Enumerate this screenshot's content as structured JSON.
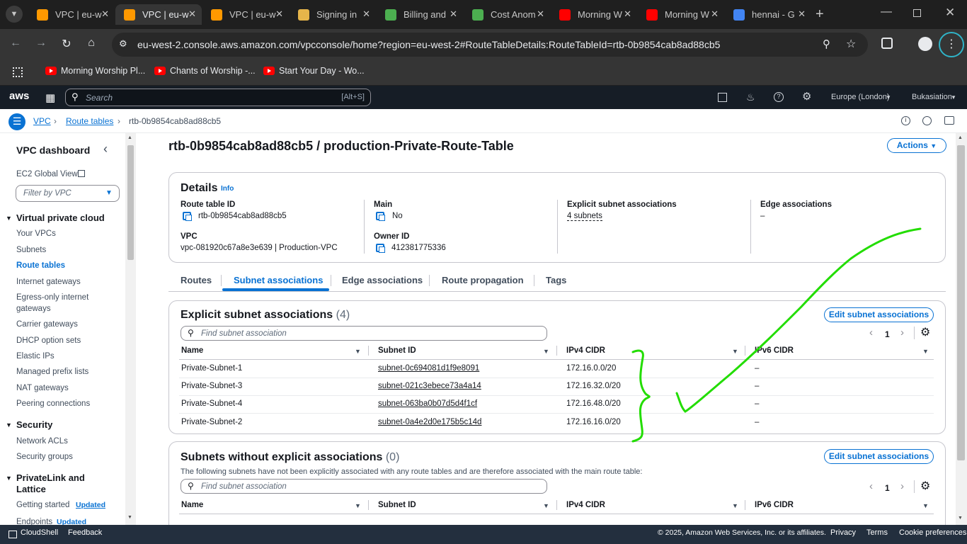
{
  "browser": {
    "tabs": [
      {
        "title": "VPC | eu-w",
        "favicon": "aws-cube-icon",
        "color": "#f90"
      },
      {
        "title": "VPC | eu-w",
        "favicon": "aws-cube-icon",
        "color": "#f90"
      },
      {
        "title": "VPC | eu-w",
        "favicon": "aws-cube-icon",
        "color": "#f90"
      },
      {
        "title": "Signing in",
        "favicon": "package-icon",
        "color": "#e6b54a"
      },
      {
        "title": "Billing and",
        "favicon": "billing-icon",
        "color": "#4caf50"
      },
      {
        "title": "Cost Anom",
        "favicon": "cost-icon",
        "color": "#4caf50"
      },
      {
        "title": "Morning W",
        "favicon": "youtube-icon",
        "color": "#f00"
      },
      {
        "title": "Morning W",
        "favicon": "youtube-icon",
        "color": "#f00"
      },
      {
        "title": "hennai - G",
        "favicon": "google-icon",
        "color": "#4285f4"
      }
    ],
    "url": "eu-west-2.console.aws.amazon.com/vpcconsole/home?region=eu-west-2#RouteTableDetails:RouteTableId=rtb-0b9854cab8ad88cb5",
    "bookmarks": [
      "Morning Worship Pl...",
      "Chants of Worship -...",
      "Start Your Day - Wo..."
    ]
  },
  "aws": {
    "logo": "aws",
    "search_placeholder": "Search",
    "search_shortcut": "[Alt+S]",
    "region": "Europe (London)",
    "account": "Bukasiation"
  },
  "breadcrumb": [
    "VPC",
    "Route tables",
    "rtb-0b9854cab8ad88cb5"
  ],
  "sidebar": {
    "title": "VPC dashboard",
    "ec2_global": "EC2 Global View",
    "filter_placeholder": "Filter by VPC",
    "sections": [
      {
        "header": "Virtual private cloud",
        "items": [
          "Your VPCs",
          "Subnets",
          "Route tables",
          "Internet gateways",
          "Egress-only internet",
          "gateways",
          "Carrier gateways",
          "DHCP option sets",
          "Elastic IPs",
          "Managed prefix lists",
          "NAT gateways",
          "Peering connections"
        ]
      },
      {
        "header": "Security",
        "items": [
          "Network ACLs",
          "Security groups"
        ]
      },
      {
        "header_line1": "PrivateLink and",
        "header_line2": "Lattice",
        "items": [
          "Getting started",
          "Endpoints"
        ],
        "badge": "Updated"
      }
    ]
  },
  "page": {
    "title": "rtb-0b9854cab8ad88cb5 / production-Private-Route-Table",
    "actions": "Actions"
  },
  "details": {
    "heading": "Details",
    "info": "Info",
    "route_table_id_label": "Route table ID",
    "route_table_id": "rtb-0b9854cab8ad88cb5",
    "main_label": "Main",
    "main": "No",
    "explicit_label": "Explicit subnet associations",
    "explicit": "4 subnets",
    "edge_label": "Edge associations",
    "edge": "–",
    "vpc_label": "VPC",
    "vpc": "vpc-081920c67a8e3e639 | Production-VPC",
    "owner_label": "Owner ID",
    "owner": "412381775336"
  },
  "tabs": [
    "Routes",
    "Subnet associations",
    "Edge associations",
    "Route propagation",
    "Tags"
  ],
  "explicit_table": {
    "title": "Explicit subnet associations",
    "count": "(4)",
    "edit": "Edit subnet associations",
    "filter_placeholder": "Find subnet association",
    "page": "1",
    "columns": [
      "Name",
      "Subnet ID",
      "IPv4 CIDR",
      "IPv6 CIDR"
    ],
    "rows": [
      {
        "name": "Private-Subnet-1",
        "subnet": "subnet-0c694081d1f9e8091",
        "ipv4": "172.16.0.0/20",
        "ipv6": "–"
      },
      {
        "name": "Private-Subnet-3",
        "subnet": "subnet-021c3ebece73a4a14",
        "ipv4": "172.16.32.0/20",
        "ipv6": "–"
      },
      {
        "name": "Private-Subnet-4",
        "subnet": "subnet-063ba0b07d5d4f1cf",
        "ipv4": "172.16.48.0/20",
        "ipv6": "–"
      },
      {
        "name": "Private-Subnet-2",
        "subnet": "subnet-0a4e2d0e175b5c14d",
        "ipv4": "172.16.16.0/20",
        "ipv6": "–"
      }
    ]
  },
  "implicit_table": {
    "title": "Subnets without explicit associations",
    "count": "(0)",
    "edit": "Edit subnet associations",
    "description": "The following subnets have not been explicitly associated with any route tables and are therefore associated with the main route table:",
    "filter_placeholder": "Find subnet association",
    "page": "1",
    "columns": [
      "Name",
      "Subnet ID",
      "IPv4 CIDR",
      "IPv6 CIDR"
    ]
  },
  "footer": {
    "cloudshell": "CloudShell",
    "feedback": "Feedback",
    "copyright": "© 2025, Amazon Web Services, Inc. or its affiliates.",
    "privacy": "Privacy",
    "terms": "Terms",
    "cookies": "Cookie preferences"
  },
  "colors": {
    "accent": "#0972d3",
    "annotation": "#22dd00"
  }
}
